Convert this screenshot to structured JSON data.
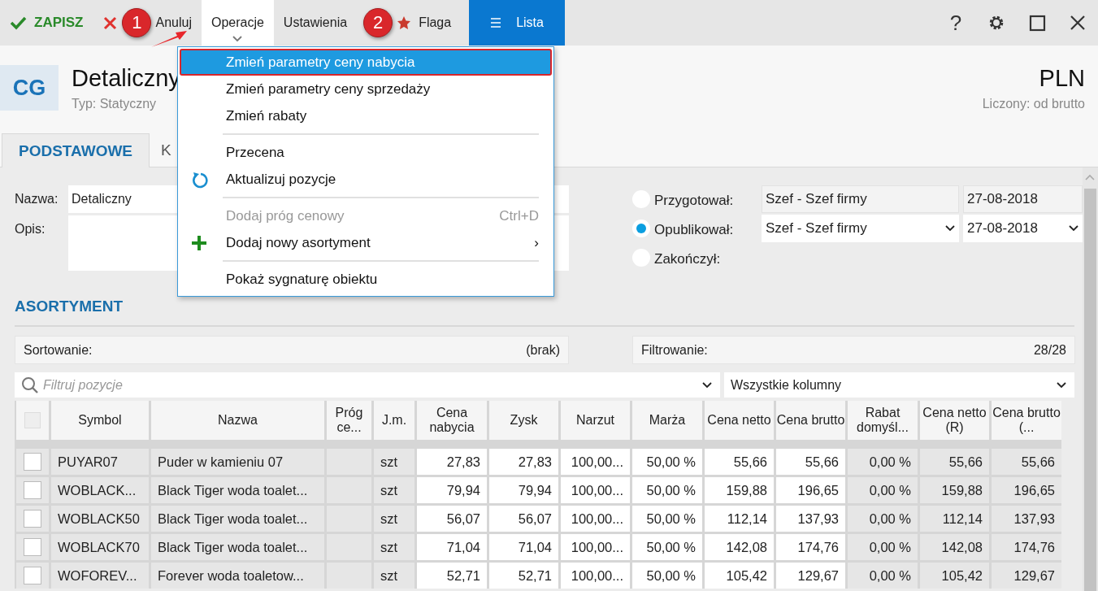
{
  "toolbar": {
    "items": [
      {
        "kind": "save",
        "label": "ZAPISZ",
        "selected": false
      },
      {
        "kind": "cancel",
        "label": "Anuluj",
        "selected": false,
        "step": "1"
      },
      {
        "kind": "menu",
        "label": "Operacje",
        "selected": true
      },
      {
        "kind": "plain",
        "label": "Ustawienia",
        "selected": false
      },
      {
        "kind": "flag",
        "label": "Flaga",
        "selected": false,
        "step": "2"
      },
      {
        "kind": "list",
        "label": "Lista",
        "selected": false
      }
    ],
    "window_controls": [
      {
        "kind": "help",
        "glyph": "?"
      },
      {
        "kind": "settings"
      },
      {
        "kind": "maximize"
      },
      {
        "kind": "close"
      }
    ]
  },
  "header": {
    "badge": "CG",
    "title": "Detaliczny",
    "subtitle": "Typ: Statyczny",
    "currency": "PLN",
    "computed": "Liczony: od brutto"
  },
  "tabs": [
    {
      "label": "PODSTAWOWE",
      "selected": true
    },
    {
      "label": "K",
      "selected": false
    }
  ],
  "form": {
    "name_label": "Nazwa:",
    "name_value": "Detaliczny",
    "description_label": "Opis:"
  },
  "workflow": [
    {
      "label": "Przygotował:",
      "selected": false,
      "person": "Szef - Szef firmy",
      "date": "27-08-2018",
      "editable": false
    },
    {
      "label": "Opublikował:",
      "selected": true,
      "person": "Szef - Szef firmy",
      "date": "27-08-2018",
      "editable": true
    },
    {
      "label": "Zakończył:",
      "selected": false
    }
  ],
  "section_title": "ASORTYMENT",
  "sorting": {
    "label": "Sortowanie:",
    "value": "(brak)"
  },
  "filtering": {
    "label": "Filtrowanie:",
    "value": "28/28"
  },
  "filter": {
    "placeholder": "Filtruj pozycje",
    "columns": "Wszystkie kolumny"
  },
  "table": {
    "all_checked": false,
    "columns": [
      {
        "label": "Symbol",
        "editable": false,
        "kind": "text"
      },
      {
        "label": "Nazwa",
        "editable": false,
        "kind": "text"
      },
      {
        "label": "Próg ce...",
        "editable": false,
        "kind": "text"
      },
      {
        "label": "J.m.",
        "editable": false,
        "kind": "text"
      },
      {
        "label": "Cena nabycia",
        "editable": true,
        "kind": "number"
      },
      {
        "label": "Zysk",
        "editable": true,
        "kind": "number"
      },
      {
        "label": "Narzut",
        "editable": true,
        "kind": "number"
      },
      {
        "label": "Marża",
        "editable": true,
        "kind": "number"
      },
      {
        "label": "Cena netto",
        "editable": true,
        "kind": "number"
      },
      {
        "label": "Cena brutto",
        "editable": true,
        "kind": "number"
      },
      {
        "label": "Rabat domyśl...",
        "editable": false,
        "kind": "number"
      },
      {
        "label": "Cena netto (R)",
        "editable": false,
        "kind": "number"
      },
      {
        "label": "Cena brutto (...",
        "editable": false,
        "kind": "number"
      }
    ],
    "rows": [
      {
        "checked": false,
        "cells": [
          "PUYAR07",
          "Puder w kamieniu 07",
          "",
          "szt",
          "27,83",
          "27,83",
          "100,00...",
          "50,00 %",
          "55,66",
          "55,66",
          "0,00 %",
          "55,66",
          "55,66"
        ]
      },
      {
        "checked": false,
        "cells": [
          "WOBLACK...",
          "Black Tiger woda toalet...",
          "",
          "szt",
          "79,94",
          "79,94",
          "100,00...",
          "50,00 %",
          "159,88",
          "196,65",
          "0,00 %",
          "159,88",
          "196,65"
        ]
      },
      {
        "checked": false,
        "cells": [
          "WOBLACK50",
          "Black Tiger woda toalet...",
          "",
          "szt",
          "56,07",
          "56,07",
          "100,00...",
          "50,00 %",
          "112,14",
          "137,93",
          "0,00 %",
          "112,14",
          "137,93"
        ]
      },
      {
        "checked": false,
        "cells": [
          "WOBLACK70",
          "Black Tiger woda toalet...",
          "",
          "szt",
          "71,04",
          "71,04",
          "100,00...",
          "50,00 %",
          "142,08",
          "174,76",
          "0,00 %",
          "142,08",
          "174,76"
        ]
      },
      {
        "checked": false,
        "cells": [
          "WOFOREV...",
          "Forever woda toaletow...",
          "",
          "szt",
          "52,71",
          "52,71",
          "100,00...",
          "50,00 %",
          "105,42",
          "129,67",
          "0,00 %",
          "105,42",
          "129,67"
        ]
      }
    ]
  },
  "menu": {
    "items": [
      {
        "kind": "plain",
        "label": "Zmień parametry ceny nabycia",
        "selected": true,
        "disabled": false
      },
      {
        "kind": "plain",
        "label": "Zmień parametry ceny sprzedaży",
        "selected": false,
        "disabled": false
      },
      {
        "kind": "plain",
        "label": "Zmień rabaty",
        "selected": false,
        "disabled": false
      },
      {
        "kind": "separator"
      },
      {
        "kind": "plain",
        "label": "Przecena",
        "selected": false,
        "disabled": false
      },
      {
        "kind": "refresh",
        "label": "Aktualizuj pozycje",
        "selected": false,
        "disabled": false
      },
      {
        "kind": "separator"
      },
      {
        "kind": "plain",
        "label": "Dodaj próg cenowy",
        "selected": false,
        "disabled": true,
        "shortcut": "Ctrl+D"
      },
      {
        "kind": "add",
        "label": "Dodaj nowy asortyment",
        "selected": false,
        "disabled": false,
        "submenu": "›"
      },
      {
        "kind": "separator"
      },
      {
        "kind": "plain",
        "label": "Pokaż sygnaturę obiektu",
        "selected": false,
        "disabled": false
      }
    ]
  }
}
